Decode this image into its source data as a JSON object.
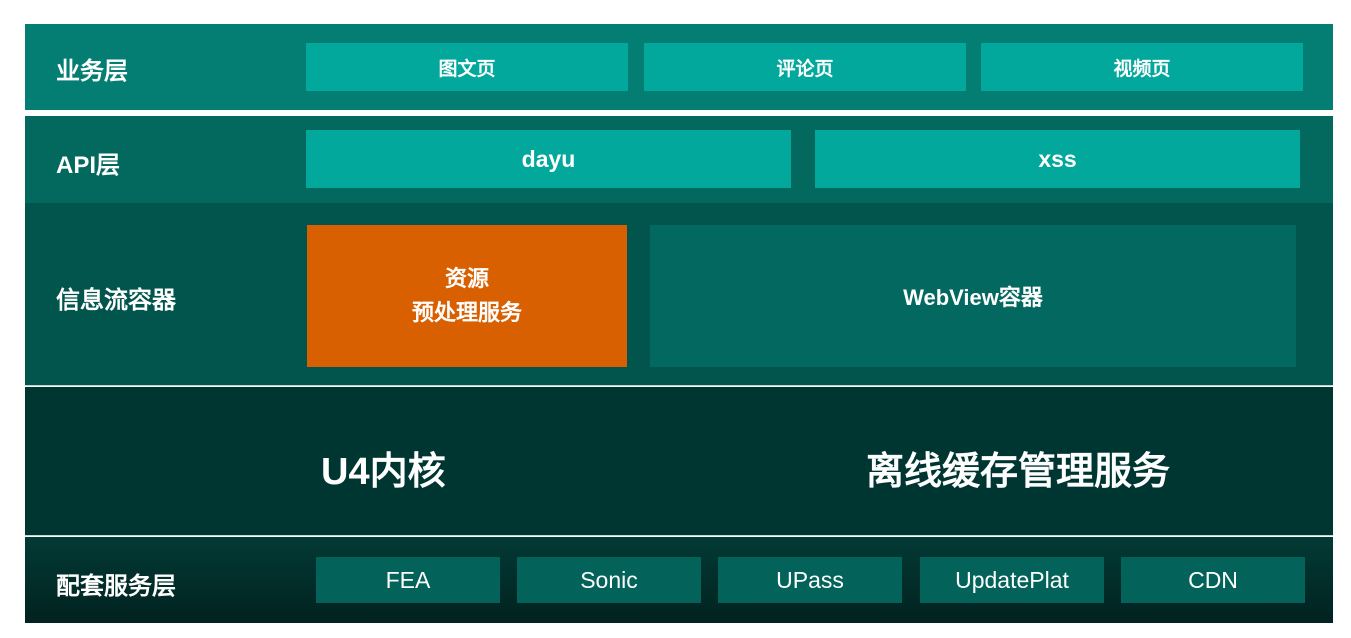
{
  "layers": {
    "business": {
      "label": "业务层",
      "items": [
        "图文页",
        "评论页",
        "视频页"
      ]
    },
    "api": {
      "label": "API层",
      "items": [
        "dayu",
        "xss"
      ]
    },
    "container": {
      "label": "信息流容器",
      "resource_box": [
        "资源",
        "预处理服务"
      ],
      "webview_box": "WebView容器"
    },
    "core": {
      "kernel": "U4内核",
      "offline_cache": "离线缓存管理服务"
    },
    "support": {
      "label": "配套服务层",
      "items": [
        "FEA",
        "Sonic",
        "UPass",
        "UpdatePlat",
        "CDN"
      ]
    }
  },
  "colors": {
    "teal_box": "#03a89c",
    "orange_box": "#d96001",
    "layer_business": "#047d73",
    "layer_api": "#03695f",
    "layer_container": "#01554d",
    "layer_core": "#003632",
    "layer_support": "#012220"
  }
}
